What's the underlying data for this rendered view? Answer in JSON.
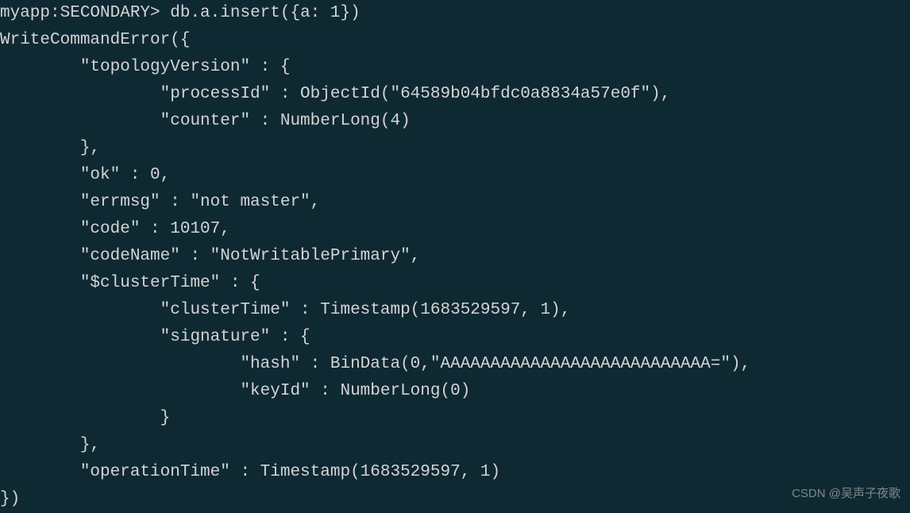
{
  "terminal": {
    "prompt": "myapp:SECONDARY> ",
    "command": "db.a.insert({a: 1})",
    "output_lines": [
      "WriteCommandError({",
      "        \"topologyVersion\" : {",
      "                \"processId\" : ObjectId(\"64589b04bfdc0a8834a57e0f\"),",
      "                \"counter\" : NumberLong(4)",
      "        },",
      "        \"ok\" : 0,",
      "        \"errmsg\" : \"not master\",",
      "        \"code\" : 10107,",
      "        \"codeName\" : \"NotWritablePrimary\",",
      "        \"$clusterTime\" : {",
      "                \"clusterTime\" : Timestamp(1683529597, 1),",
      "                \"signature\" : {",
      "                        \"hash\" : BinData(0,\"AAAAAAAAAAAAAAAAAAAAAAAAAAA=\"),",
      "                        \"keyId\" : NumberLong(0)",
      "                }",
      "        },",
      "        \"operationTime\" : Timestamp(1683529597, 1)",
      "})"
    ]
  },
  "watermark": "CSDN @吴声子夜歌"
}
